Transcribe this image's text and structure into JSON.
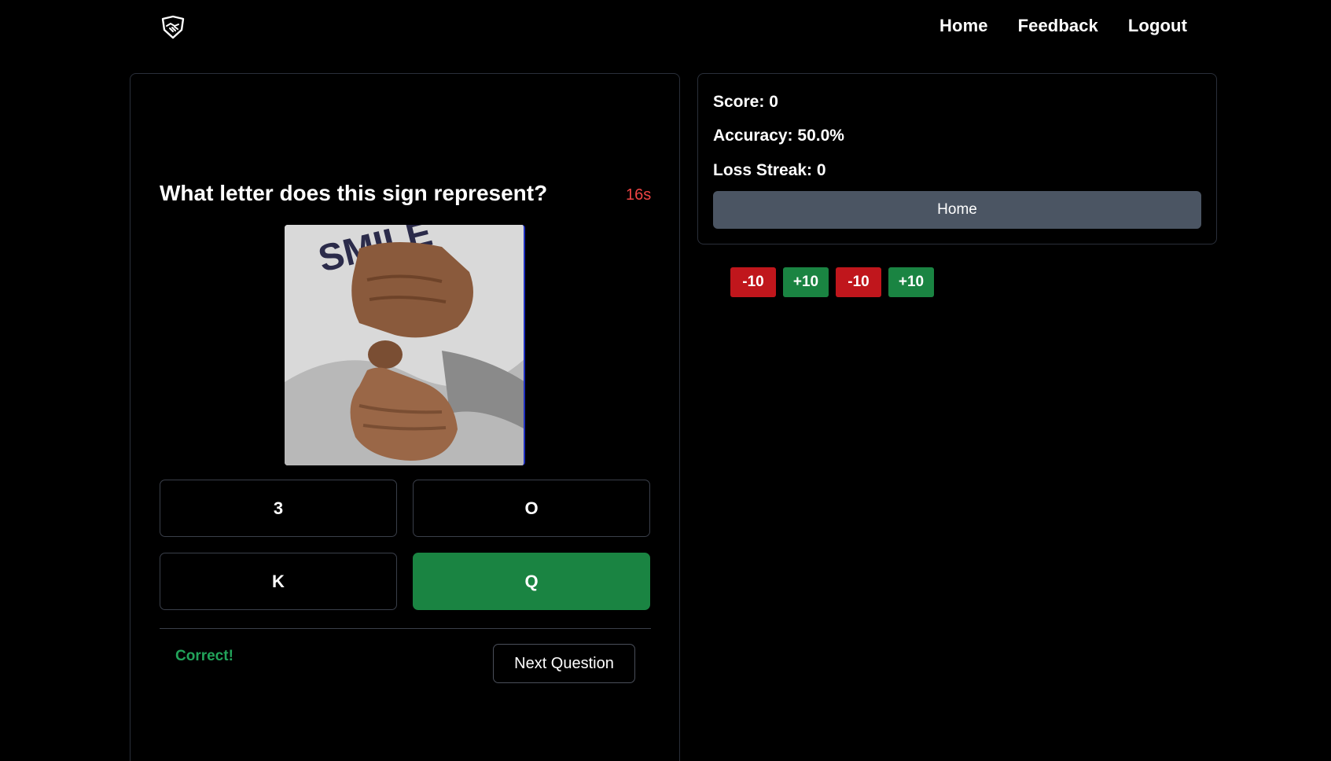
{
  "nav": {
    "home": "Home",
    "feedback": "Feedback",
    "logout": "Logout"
  },
  "quiz": {
    "question": "What letter does this sign represent?",
    "timer": "16s",
    "image_text": "SMILE",
    "answers": [
      "3",
      "O",
      "K",
      "Q"
    ],
    "correct_answer": "Q",
    "feedback": "Correct!",
    "next_label": "Next Question"
  },
  "stats": {
    "score": "Score: 0",
    "accuracy": "Accuracy: 50.0%",
    "loss_streak": "Loss Streak: 0",
    "home_label": "Home"
  },
  "history": [
    "-10",
    "+10",
    "-10",
    "+10"
  ],
  "colors": {
    "background": "#000000",
    "correct": "#1a8442",
    "loss": "#c0161c",
    "timer": "#ef4444",
    "button_gray": "#4b5563"
  }
}
